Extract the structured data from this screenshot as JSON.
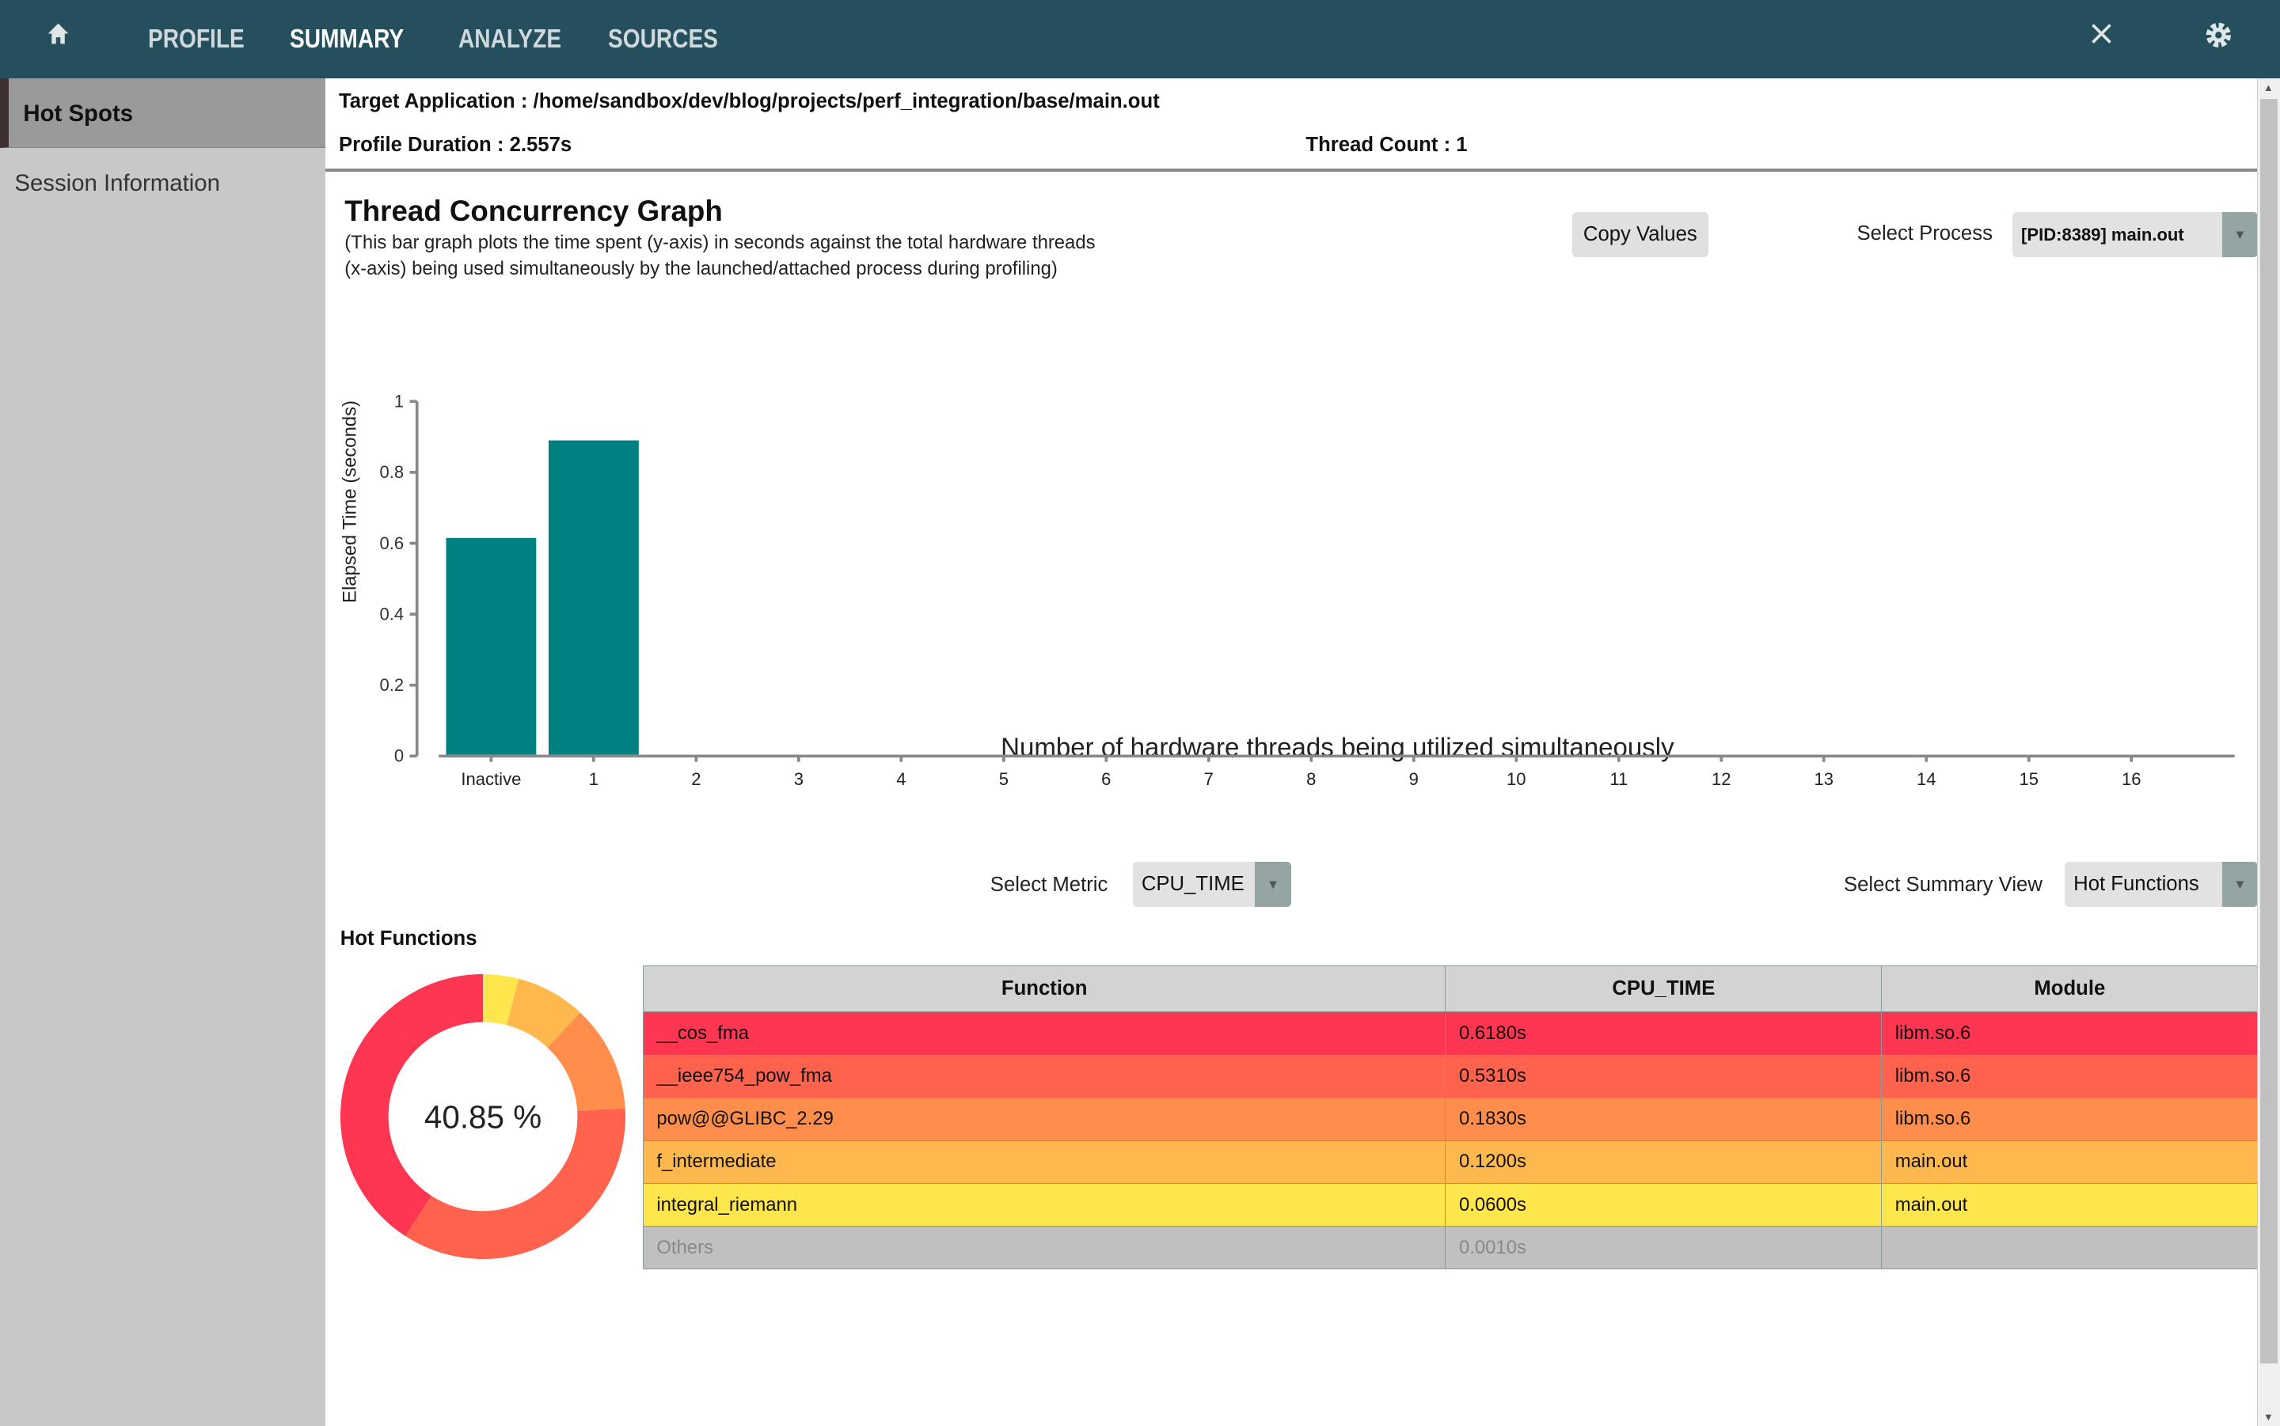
{
  "nav": {
    "items": [
      "PROFILE",
      "SUMMARY",
      "ANALYZE",
      "SOURCES"
    ],
    "active": "SUMMARY",
    "icons": [
      "home-icon",
      "close-icon",
      "gear-icon"
    ]
  },
  "sidebar": {
    "items": [
      {
        "label": "Hot Spots",
        "active": true
      },
      {
        "label": "Session Information",
        "active": false
      }
    ]
  },
  "header": {
    "target": "Target Application : /home/sandbox/dev/blog/projects/perf_integration/base/main.out",
    "duration": "Profile Duration : 2.557s",
    "threads": "Thread Count : 1"
  },
  "concurrency": {
    "title": "Thread Concurrency Graph",
    "desc1": "(This bar graph plots the time spent (y-axis) in seconds against the total hardware threads",
    "desc2": "(x-axis) being used simultaneously by the launched/attached process during profiling)",
    "copy_label": "Copy Values",
    "process_label": "Select Process",
    "process_value": "[PID:8389] main.out"
  },
  "metric": {
    "label": "Select Metric",
    "value": "CPU_TIME"
  },
  "summary_view": {
    "label": "Select Summary View",
    "value": "Hot Functions"
  },
  "hot": {
    "title": "Hot Functions",
    "center_label": "40.85 %",
    "columns": [
      "Function",
      "CPU_TIME",
      "Module"
    ],
    "rows": [
      {
        "function": "__cos_fma",
        "cpu": "0.6180s",
        "module": "libm.so.6",
        "color": "#ff3652",
        "value": 0.618
      },
      {
        "function": "__ieee754_pow_fma",
        "cpu": "0.5310s",
        "module": "libm.so.6",
        "color": "#ff624d",
        "value": 0.531
      },
      {
        "function": "pow@@GLIBC_2.29",
        "cpu": "0.1830s",
        "module": "libm.so.6",
        "color": "#ff8e4d",
        "value": 0.183
      },
      {
        "function": "f_intermediate",
        "cpu": "0.1200s",
        "module": "main.out",
        "color": "#ffb84d",
        "value": 0.12
      },
      {
        "function": "integral_riemann",
        "cpu": "0.0600s",
        "module": "main.out",
        "color": "#ffe64d",
        "value": 0.06
      },
      {
        "function": "Others",
        "cpu": "0.0010s",
        "module": "",
        "color": "#c0c0c0",
        "value": 0.001
      }
    ]
  },
  "chart_data": {
    "type": "bar",
    "categories": [
      "Inactive",
      "1",
      "2",
      "3",
      "4",
      "5",
      "6",
      "7",
      "8",
      "9",
      "10",
      "11",
      "12",
      "13",
      "14",
      "15",
      "16"
    ],
    "values": [
      0.615,
      0.89,
      0,
      0,
      0,
      0,
      0,
      0,
      0,
      0,
      0,
      0,
      0,
      0,
      0,
      0,
      0
    ],
    "xlabel": "Number of hardware threads being utilized simultaneously",
    "ylabel": "Elapsed Time (seconds)",
    "ylim": [
      0,
      1
    ],
    "yticks": [
      "0",
      "0.2",
      "0.4",
      "0.6",
      "0.8",
      "1"
    ],
    "color": "#008080",
    "grid": false
  }
}
